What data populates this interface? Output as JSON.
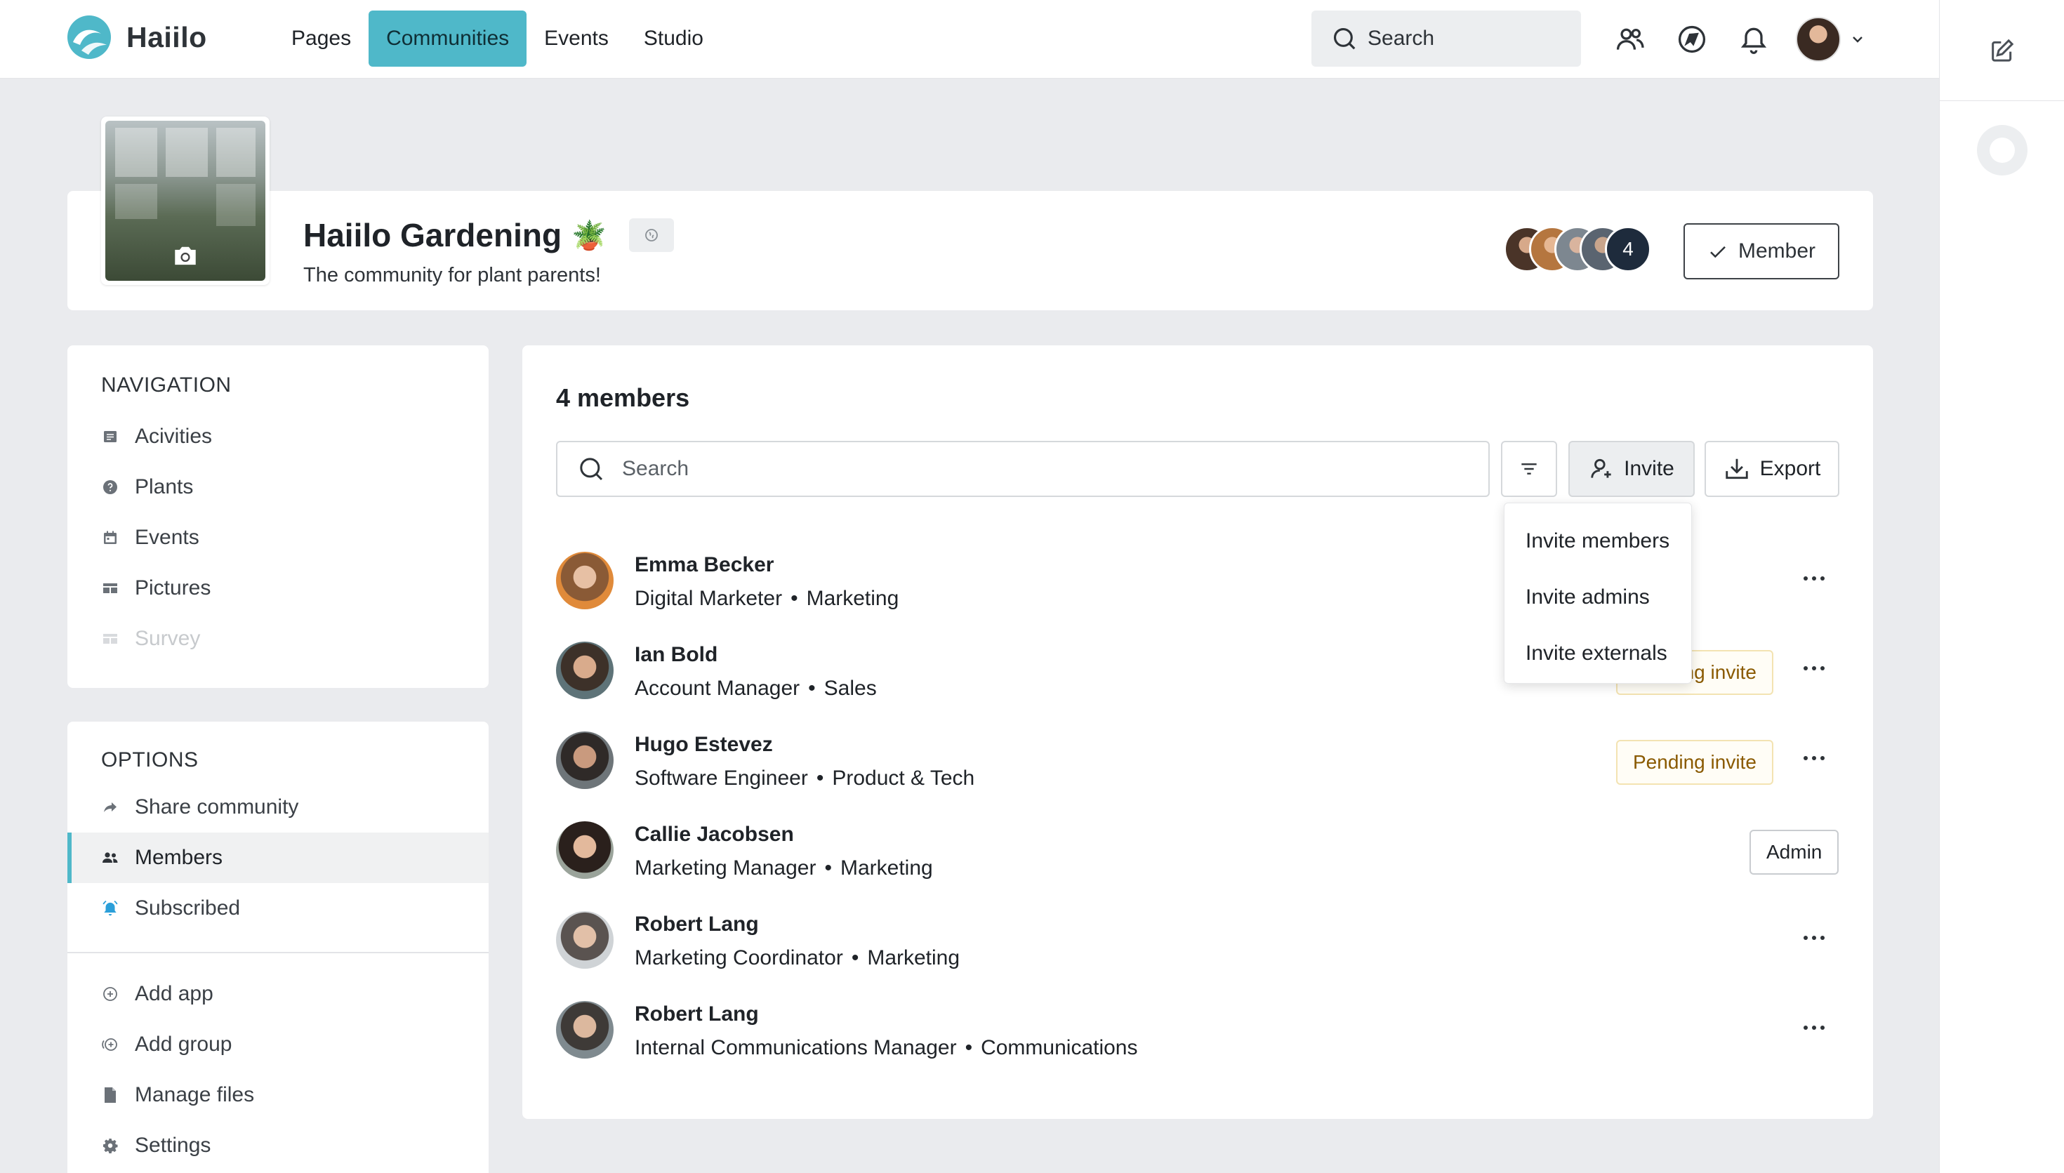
{
  "app": {
    "name": "Haiilo",
    "nav": [
      "Pages",
      "Communities",
      "Events",
      "Studio"
    ],
    "active_nav": "Communities",
    "search_label": "Search"
  },
  "community": {
    "title": "Haiilo Gardening",
    "emoji": "🪴",
    "subtitle": "The community for plant parents!",
    "member_count_badge": "4",
    "member_button": "Member"
  },
  "sidebar": {
    "navigation_heading": "NAVIGATION",
    "navigation_items": [
      {
        "label": "Acivities",
        "icon": "list-icon"
      },
      {
        "label": "Plants",
        "icon": "question-circle-icon"
      },
      {
        "label": "Events",
        "icon": "calendar-icon"
      },
      {
        "label": "Pictures",
        "icon": "gallery-icon"
      },
      {
        "label": "Survey",
        "icon": "gallery-icon",
        "disabled": true
      }
    ],
    "options_heading": "OPTIONS",
    "options_items": [
      {
        "label": "Share community",
        "icon": "share-icon"
      },
      {
        "label": "Members",
        "icon": "members-icon",
        "active": true
      },
      {
        "label": "Subscribed",
        "icon": "bell-icon"
      }
    ],
    "admin_items": [
      {
        "label": "Add app",
        "icon": "plus-circle-icon"
      },
      {
        "label": "Add group",
        "icon": "add-group-icon"
      },
      {
        "label": "Manage files",
        "icon": "file-icon"
      },
      {
        "label": "Settings",
        "icon": "gear-icon"
      }
    ]
  },
  "members": {
    "title": "4 members",
    "search_placeholder": "Search",
    "invite_label": "Invite",
    "export_label": "Export",
    "invite_menu": [
      "Invite members",
      "Invite admins",
      "Invite externals"
    ],
    "list": [
      {
        "name": "Emma Becker",
        "role": "Digital Marketer",
        "dept": "Marketing",
        "badge": ""
      },
      {
        "name": "Ian Bold",
        "role": "Account Manager",
        "dept": "Sales",
        "badge": "Pending invite"
      },
      {
        "name": "Hugo Estevez",
        "role": "Software Engineer",
        "dept": "Product & Tech",
        "badge": "Pending invite"
      },
      {
        "name": "Callie Jacobsen",
        "role": "Marketing Manager",
        "dept": "Marketing",
        "badge": "Admin"
      },
      {
        "name": "Robert Lang",
        "role": "Marketing Coordinator",
        "dept": "Marketing",
        "badge": ""
      },
      {
        "name": "Robert Lang",
        "role": "Internal Communications Manager",
        "dept": "Communications",
        "badge": ""
      }
    ]
  },
  "colors": {
    "accent": "#4fb8c9",
    "pending_text": "#8a5a00",
    "background": "#eaebee"
  }
}
